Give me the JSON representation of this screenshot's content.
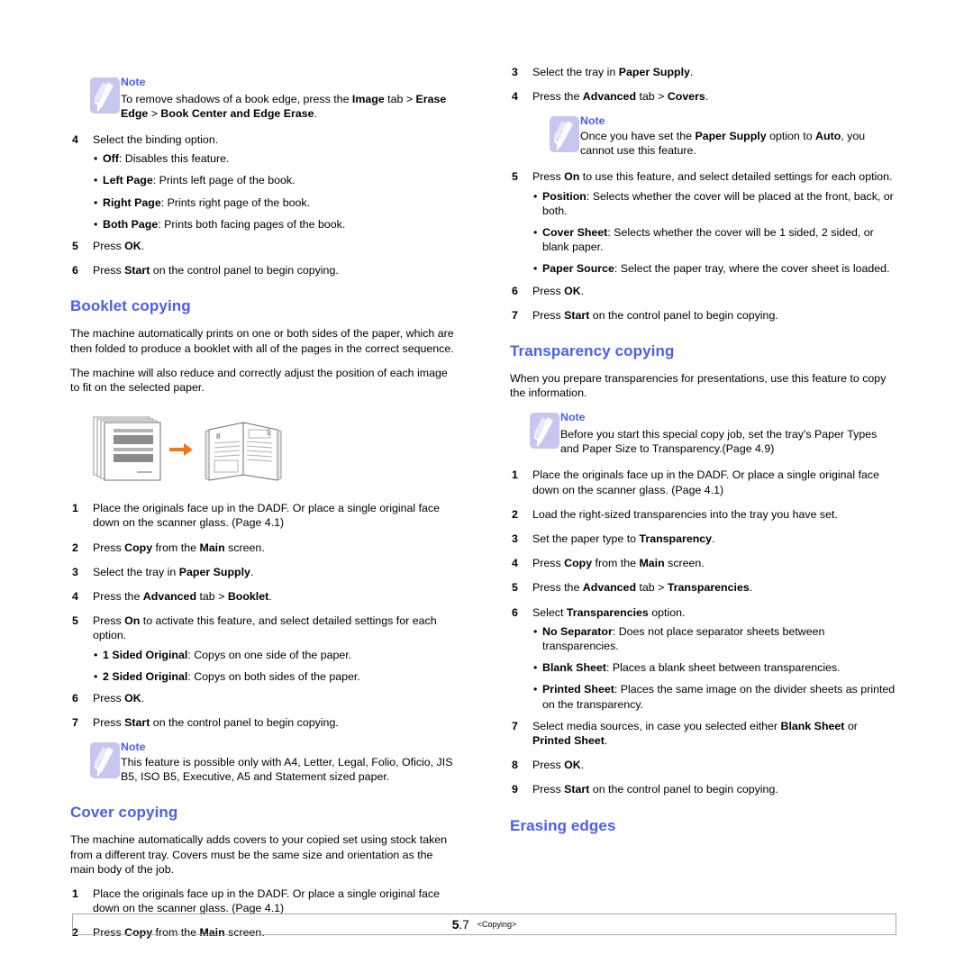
{
  "document": {
    "footer": {
      "page_number": "5.7",
      "page_number_bold_part": "5",
      "page_number_rest": ".7",
      "chapter": "<Copying>"
    },
    "accent_color": "#4a5ef2",
    "note_icon_color": "#c6c6ee",
    "arrow_color": "#f07818"
  },
  "left_column": {
    "note_image_edge": {
      "title": "Note",
      "body_prefix": "To remove shadows of a book edge, press the ",
      "body_bold1": "Image",
      "body_mid1": " tab > ",
      "body_bold2": "Erase Edge",
      "body_mid2": " > ",
      "body_bold3": "Book Center and Edge Erase",
      "body_suffix": "."
    },
    "step4_binding": {
      "num": "4",
      "text": "Select the binding option."
    },
    "binding_bullets": [
      {
        "dot": "•",
        "bold": "Off",
        "rest": ": Disables this feature."
      },
      {
        "dot": "•",
        "bold": "Left Page",
        "rest": ": Prints left page of the book."
      },
      {
        "dot": "•",
        "bold": "Right Page",
        "rest": ": Prints right page of the book."
      },
      {
        "dot": "•",
        "bold": "Both Page",
        "rest": ": Prints both facing pages of the book."
      }
    ],
    "step5_ok": {
      "num": "5",
      "prefix": "Press ",
      "bold": "OK",
      "suffix": "."
    },
    "step6_start": {
      "num": "6",
      "prefix": "Press ",
      "bold": "Start",
      "suffix": " on the control panel to begin copying."
    },
    "booklet_heading": "Booklet copying",
    "booklet_para1": "The machine automatically prints on one or both sides of the paper, which are then folded to produce a booklet with all of the pages in the correct sequence.",
    "booklet_para2": "The machine will also reduce and correctly adjust the position of each image to fit on the selected paper.",
    "booklet_illustration": {
      "left_label": "document-stack",
      "arrow": "arrow-right",
      "right_label": "open-booklet",
      "page_num_left": "8",
      "page_num_right": "9"
    },
    "booklet_steps": [
      {
        "num": "1",
        "text": "Place the originals face up in the DADF. Or place a single original face down on the scanner glass. (Page 4.1)"
      }
    ],
    "booklet_step2": {
      "num": "2",
      "prefix": "Press ",
      "bold1": "Copy",
      "mid": " from the ",
      "bold2": "Main",
      "suffix": " screen."
    },
    "booklet_step3": {
      "num": "3",
      "prefix": "Select the tray in ",
      "bold1": "Paper Supply",
      "suffix": "."
    },
    "booklet_step4": {
      "num": "4",
      "prefix": "Press the ",
      "bold1": "Advanced",
      "mid": " tab > ",
      "bold2": "Booklet",
      "suffix": "."
    },
    "booklet_step5": {
      "num": "5",
      "prefix": "Press ",
      "bold1": "On",
      "suffix": " to activate this feature, and select detailed settings for each option."
    },
    "booklet_bullets": [
      {
        "dot": "•",
        "bold": "1 Sided Original",
        "rest": ": Copys on one side of the paper."
      },
      {
        "dot": "•",
        "bold": "2 Sided Original",
        "rest": ": Copys on both sides of the paper."
      }
    ],
    "booklet_step6": {
      "num": "6",
      "prefix": "Press ",
      "bold": "OK",
      "suffix": "."
    },
    "booklet_step7": {
      "num": "7",
      "prefix": "Press ",
      "bold": "Start",
      "suffix": " on the control panel to begin copying."
    },
    "note_paper_sizes": {
      "title": "Note",
      "body": "This feature is possible only with A4, Letter, Legal, Folio, Oficio, JIS B5, ISO B5, Executive, A5 and Statement sized paper."
    },
    "cover_heading": "Cover copying",
    "cover_para": "The machine automatically adds covers to your copied set using stock taken from a different tray. Covers must be the same size and orientation as the main body of the job.",
    "cover_step1": {
      "num": "1",
      "text": "Place the originals face up in the DADF. Or place a single original face down on the scanner glass. (Page 4.1)"
    },
    "cover_step2": {
      "num": "2",
      "prefix": "Press ",
      "bold1": "Copy",
      "mid": " from the ",
      "bold2": "Main",
      "suffix": " screen."
    }
  },
  "right_column": {
    "cover_step3": {
      "num": "3",
      "prefix": "Select the tray in ",
      "bold1": "Paper Supply",
      "suffix": "."
    },
    "cover_step4": {
      "num": "4",
      "prefix": "Press the ",
      "bold1": "Advanced",
      "mid": " tab > ",
      "bold2": "Covers",
      "suffix": "."
    },
    "note_paper_supply_auto": {
      "title": "Note",
      "prefix": "Once you have set the ",
      "bold1": "Paper Supply",
      "mid": " option to ",
      "bold2": "Auto",
      "suffix": ", you cannot use this feature."
    },
    "cover_step5": {
      "num": "5",
      "prefix": "Press ",
      "bold1": "On",
      "suffix": " to use this feature, and select detailed settings for each option."
    },
    "cover_bullets": [
      {
        "dot": "•",
        "bold": "Position",
        "rest": ": Selects whether the cover will be placed at the front, back, or both."
      },
      {
        "dot": "•",
        "bold": "Cover Sheet",
        "rest": ": Selects whether the cover will be 1 sided, 2 sided, or blank paper."
      },
      {
        "dot": "•",
        "bold": "Paper Source",
        "rest": ": Select the paper tray, where the cover sheet is loaded."
      }
    ],
    "cover_step6": {
      "num": "6",
      "prefix": "Press ",
      "bold": "OK",
      "suffix": "."
    },
    "cover_step7": {
      "num": "7",
      "prefix": "Press ",
      "bold": "Start",
      "suffix": " on the control panel to begin copying."
    },
    "transparency_heading": "Transparency copying",
    "transparency_para": "When you prepare transparencies for presentations, use this feature to copy the information.",
    "note_transparency": {
      "title": "Note",
      "body": "Before you start this special copy job, set the tray's Paper Types and Paper Size to Transparency.(Page  4.9)"
    },
    "transparency_step1": {
      "num": "1",
      "text": "Place the originals face up in the DADF. Or place a single original face down on the scanner glass. (Page 4.1)"
    },
    "transparency_step2": {
      "num": "2",
      "text": "Load the right-sized transparencies into the tray you have set."
    },
    "transparency_step3": {
      "num": "3",
      "prefix": "Set the paper type to ",
      "bold1": "Transparency",
      "suffix": "."
    },
    "transparency_step4": {
      "num": "4",
      "prefix": "Press ",
      "bold1": "Copy",
      "mid": " from the ",
      "bold2": "Main",
      "suffix": " screen."
    },
    "transparency_step5": {
      "num": "5",
      "prefix": "Press the ",
      "bold1": "Advanced",
      "mid": " tab > ",
      "bold2": "Transparencies",
      "suffix": "."
    },
    "transparency_step6": {
      "num": "6",
      "prefix": "Select ",
      "bold1": "Transparencies",
      "suffix": " option."
    },
    "transparency_bullets": [
      {
        "dot": "•",
        "bold": "No Separator",
        "rest": ": Does not place separator sheets between transparencies."
      },
      {
        "dot": "•",
        "bold": "Blank Sheet",
        "rest": ": Places a blank sheet between transparencies."
      },
      {
        "dot": "•",
        "bold": "Printed Sheet",
        "rest": ": Places the same image on the divider sheets as printed on the transparency."
      }
    ],
    "transparency_step7": {
      "num": "7",
      "prefix": "Select media sources, in case you selected either ",
      "bold1": "Blank Sheet",
      "mid": " or ",
      "bold2": "Printed Sheet",
      "suffix": "."
    },
    "transparency_step8": {
      "num": "8",
      "prefix": "Press ",
      "bold": "OK",
      "suffix": "."
    },
    "transparency_step9": {
      "num": "9",
      "prefix": "Press ",
      "bold": "Start",
      "suffix": " on the control panel to begin copying."
    },
    "erasing_heading": "Erasing edges"
  }
}
